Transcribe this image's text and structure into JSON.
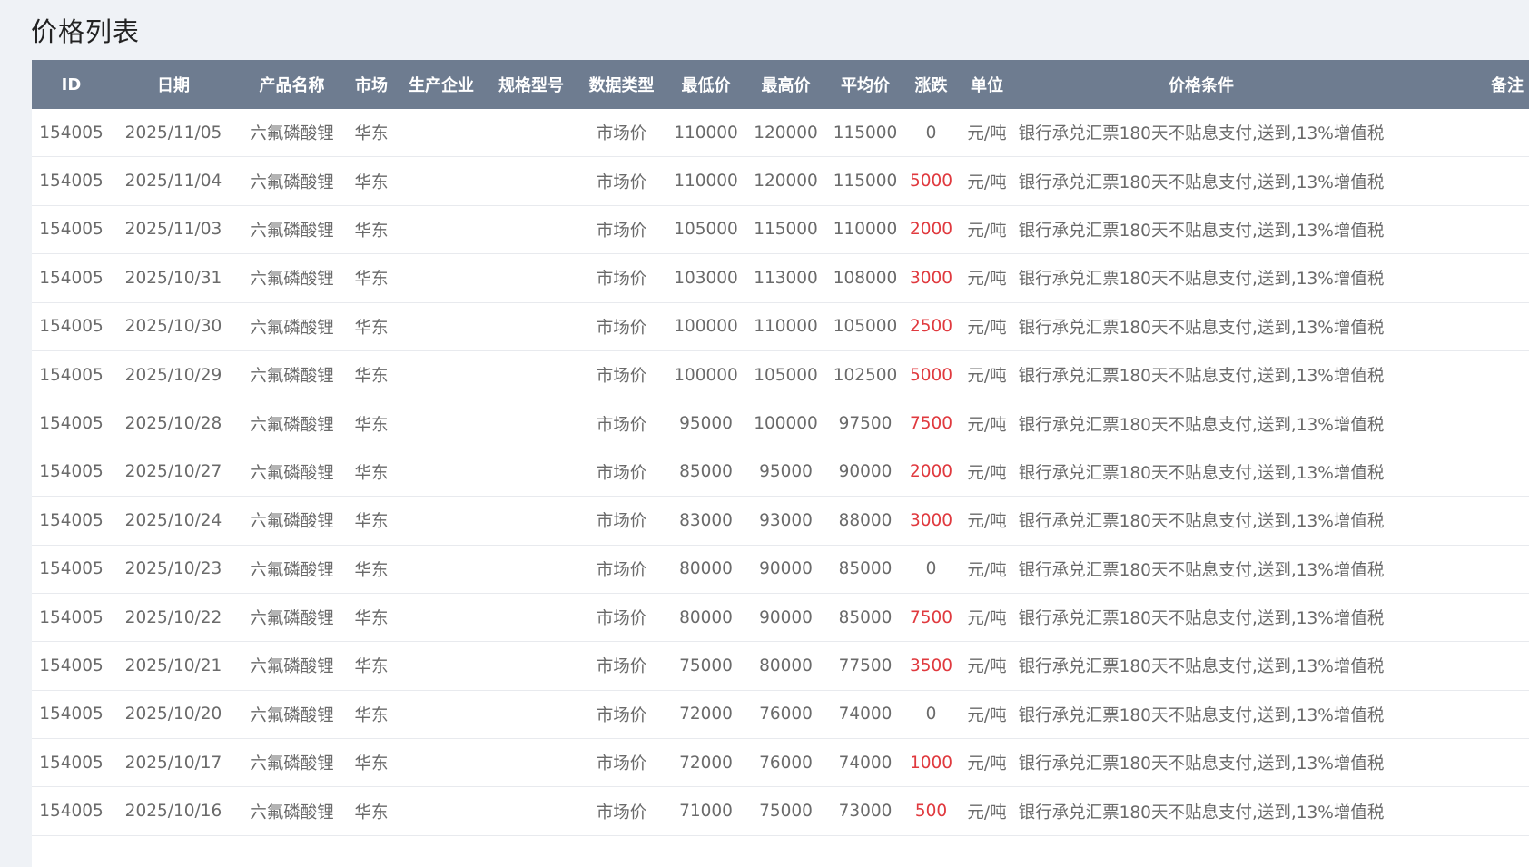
{
  "page": {
    "title": "价格列表"
  },
  "colors": {
    "header_bg": "#6e7c90",
    "header_text": "#ffffff",
    "page_bg": "#eff2f6",
    "up_change": "#e0393e",
    "cell_text": "#6a6a6a"
  },
  "table": {
    "headers": {
      "id": "ID",
      "date": "日期",
      "product": "产品名称",
      "market": "市场",
      "producer": "生产企业",
      "spec": "规格型号",
      "data_type": "数据类型",
      "low": "最低价",
      "high": "最高价",
      "avg": "平均价",
      "change": "涨跌",
      "unit": "单位",
      "condition": "价格条件",
      "remark": "备注"
    },
    "rows": [
      {
        "id": "154005",
        "date": "2025/11/05",
        "product": "六氟磷酸锂",
        "market": "华东",
        "producer": "",
        "spec": "",
        "data_type": "市场价",
        "low": "110000",
        "high": "120000",
        "avg": "115000",
        "change": "0",
        "unit": "元/吨",
        "condition": "银行承兑汇票180天不贴息支付,送到,13%增值税",
        "remark": ""
      },
      {
        "id": "154005",
        "date": "2025/11/04",
        "product": "六氟磷酸锂",
        "market": "华东",
        "producer": "",
        "spec": "",
        "data_type": "市场价",
        "low": "110000",
        "high": "120000",
        "avg": "115000",
        "change": "5000",
        "unit": "元/吨",
        "condition": "银行承兑汇票180天不贴息支付,送到,13%增值税",
        "remark": ""
      },
      {
        "id": "154005",
        "date": "2025/11/03",
        "product": "六氟磷酸锂",
        "market": "华东",
        "producer": "",
        "spec": "",
        "data_type": "市场价",
        "low": "105000",
        "high": "115000",
        "avg": "110000",
        "change": "2000",
        "unit": "元/吨",
        "condition": "银行承兑汇票180天不贴息支付,送到,13%增值税",
        "remark": ""
      },
      {
        "id": "154005",
        "date": "2025/10/31",
        "product": "六氟磷酸锂",
        "market": "华东",
        "producer": "",
        "spec": "",
        "data_type": "市场价",
        "low": "103000",
        "high": "113000",
        "avg": "108000",
        "change": "3000",
        "unit": "元/吨",
        "condition": "银行承兑汇票180天不贴息支付,送到,13%增值税",
        "remark": ""
      },
      {
        "id": "154005",
        "date": "2025/10/30",
        "product": "六氟磷酸锂",
        "market": "华东",
        "producer": "",
        "spec": "",
        "data_type": "市场价",
        "low": "100000",
        "high": "110000",
        "avg": "105000",
        "change": "2500",
        "unit": "元/吨",
        "condition": "银行承兑汇票180天不贴息支付,送到,13%增值税",
        "remark": ""
      },
      {
        "id": "154005",
        "date": "2025/10/29",
        "product": "六氟磷酸锂",
        "market": "华东",
        "producer": "",
        "spec": "",
        "data_type": "市场价",
        "low": "100000",
        "high": "105000",
        "avg": "102500",
        "change": "5000",
        "unit": "元/吨",
        "condition": "银行承兑汇票180天不贴息支付,送到,13%增值税",
        "remark": ""
      },
      {
        "id": "154005",
        "date": "2025/10/28",
        "product": "六氟磷酸锂",
        "market": "华东",
        "producer": "",
        "spec": "",
        "data_type": "市场价",
        "low": "95000",
        "high": "100000",
        "avg": "97500",
        "change": "7500",
        "unit": "元/吨",
        "condition": "银行承兑汇票180天不贴息支付,送到,13%增值税",
        "remark": ""
      },
      {
        "id": "154005",
        "date": "2025/10/27",
        "product": "六氟磷酸锂",
        "market": "华东",
        "producer": "",
        "spec": "",
        "data_type": "市场价",
        "low": "85000",
        "high": "95000",
        "avg": "90000",
        "change": "2000",
        "unit": "元/吨",
        "condition": "银行承兑汇票180天不贴息支付,送到,13%增值税",
        "remark": ""
      },
      {
        "id": "154005",
        "date": "2025/10/24",
        "product": "六氟磷酸锂",
        "market": "华东",
        "producer": "",
        "spec": "",
        "data_type": "市场价",
        "low": "83000",
        "high": "93000",
        "avg": "88000",
        "change": "3000",
        "unit": "元/吨",
        "condition": "银行承兑汇票180天不贴息支付,送到,13%增值税",
        "remark": ""
      },
      {
        "id": "154005",
        "date": "2025/10/23",
        "product": "六氟磷酸锂",
        "market": "华东",
        "producer": "",
        "spec": "",
        "data_type": "市场价",
        "low": "80000",
        "high": "90000",
        "avg": "85000",
        "change": "0",
        "unit": "元/吨",
        "condition": "银行承兑汇票180天不贴息支付,送到,13%增值税",
        "remark": ""
      },
      {
        "id": "154005",
        "date": "2025/10/22",
        "product": "六氟磷酸锂",
        "market": "华东",
        "producer": "",
        "spec": "",
        "data_type": "市场价",
        "low": "80000",
        "high": "90000",
        "avg": "85000",
        "change": "7500",
        "unit": "元/吨",
        "condition": "银行承兑汇票180天不贴息支付,送到,13%增值税",
        "remark": ""
      },
      {
        "id": "154005",
        "date": "2025/10/21",
        "product": "六氟磷酸锂",
        "market": "华东",
        "producer": "",
        "spec": "",
        "data_type": "市场价",
        "low": "75000",
        "high": "80000",
        "avg": "77500",
        "change": "3500",
        "unit": "元/吨",
        "condition": "银行承兑汇票180天不贴息支付,送到,13%增值税",
        "remark": ""
      },
      {
        "id": "154005",
        "date": "2025/10/20",
        "product": "六氟磷酸锂",
        "market": "华东",
        "producer": "",
        "spec": "",
        "data_type": "市场价",
        "low": "72000",
        "high": "76000",
        "avg": "74000",
        "change": "0",
        "unit": "元/吨",
        "condition": "银行承兑汇票180天不贴息支付,送到,13%增值税",
        "remark": ""
      },
      {
        "id": "154005",
        "date": "2025/10/17",
        "product": "六氟磷酸锂",
        "market": "华东",
        "producer": "",
        "spec": "",
        "data_type": "市场价",
        "low": "72000",
        "high": "76000",
        "avg": "74000",
        "change": "1000",
        "unit": "元/吨",
        "condition": "银行承兑汇票180天不贴息支付,送到,13%增值税",
        "remark": ""
      },
      {
        "id": "154005",
        "date": "2025/10/16",
        "product": "六氟磷酸锂",
        "market": "华东",
        "producer": "",
        "spec": "",
        "data_type": "市场价",
        "low": "71000",
        "high": "75000",
        "avg": "73000",
        "change": "500",
        "unit": "元/吨",
        "condition": "银行承兑汇票180天不贴息支付,送到,13%增值税",
        "remark": ""
      }
    ]
  }
}
